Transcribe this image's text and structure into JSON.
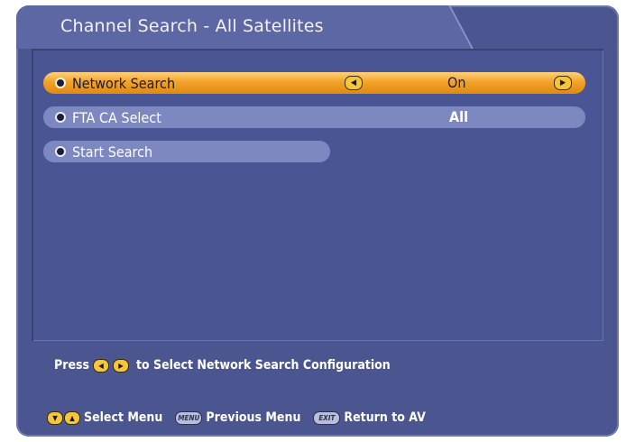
{
  "window": {
    "title": "Channel Search - All Satellites"
  },
  "menu": {
    "items": [
      {
        "label": "Network Search",
        "value": "On",
        "icons": [
          "left-arrow-key-icon",
          "right-arrow-key-icon"
        ],
        "selected": true
      },
      {
        "label": "FTA CA Select",
        "value": "All",
        "selected": false
      },
      {
        "label": "Start Search",
        "selected": false
      }
    ]
  },
  "hint": {
    "press": "Press",
    "text": "to Select Network Search Configuration",
    "icons": [
      "left-arrow-key-icon",
      "right-arrow-key-icon"
    ]
  },
  "footer": {
    "select_menu": "Select Menu",
    "menu_key": "MENU",
    "previous_menu": "Previous Menu",
    "exit_key": "EXIT",
    "return_to_av": "Return to AV",
    "icons": [
      "down-arrow-key-icon",
      "up-arrow-key-icon"
    ]
  },
  "colors": {
    "background": "#4b5590",
    "highlight": "#f3a22a",
    "row": "#7d87c0",
    "key": "#f6c63a"
  }
}
